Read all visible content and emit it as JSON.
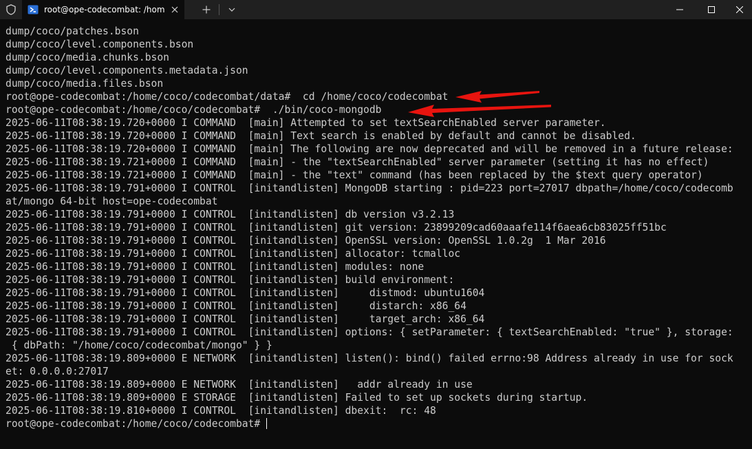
{
  "tab": {
    "title": "root@ope-codecombat: /hom",
    "icon": "powershell-icon"
  },
  "titlebar": {
    "new_tab_symbol": "+",
    "dropdown_icon": "chevron-down-icon",
    "shield_icon": "shield-icon",
    "minimize_icon": "minimize-icon",
    "maximize_icon": "maximize-icon",
    "close_icon": "close-icon"
  },
  "colors": {
    "background": "#0c0c0c",
    "titlebar": "#202020",
    "text": "#cccccc",
    "arrow": "#e8140f"
  },
  "terminal": {
    "lines": [
      "dump/coco/patches.bson",
      "dump/coco/level.components.bson",
      "dump/coco/media.chunks.bson",
      "dump/coco/level.components.metadata.json",
      "dump/coco/media.files.bson",
      "root@ope-codecombat:/home/coco/codecombat/data#  cd /home/coco/codecombat",
      "root@ope-codecombat:/home/coco/codecombat#  ./bin/coco-mongodb",
      "2025-06-11T08:38:19.720+0000 I COMMAND  [main] Attempted to set textSearchEnabled server parameter.",
      "2025-06-11T08:38:19.720+0000 I COMMAND  [main] Text search is enabled by default and cannot be disabled.",
      "2025-06-11T08:38:19.720+0000 I COMMAND  [main] The following are now deprecated and will be removed in a future release:",
      "2025-06-11T08:38:19.721+0000 I COMMAND  [main] - the \"textSearchEnabled\" server parameter (setting it has no effect)",
      "2025-06-11T08:38:19.721+0000 I COMMAND  [main] - the \"text\" command (has been replaced by the $text query operator)",
      "2025-06-11T08:38:19.791+0000 I CONTROL  [initandlisten] MongoDB starting : pid=223 port=27017 dbpath=/home/coco/codecomb",
      "at/mongo 64-bit host=ope-codecombat",
      "2025-06-11T08:38:19.791+0000 I CONTROL  [initandlisten] db version v3.2.13",
      "2025-06-11T08:38:19.791+0000 I CONTROL  [initandlisten] git version: 23899209cad60aaafe114f6aea6cb83025ff51bc",
      "2025-06-11T08:38:19.791+0000 I CONTROL  [initandlisten] OpenSSL version: OpenSSL 1.0.2g  1 Mar 2016",
      "2025-06-11T08:38:19.791+0000 I CONTROL  [initandlisten] allocator: tcmalloc",
      "2025-06-11T08:38:19.791+0000 I CONTROL  [initandlisten] modules: none",
      "2025-06-11T08:38:19.791+0000 I CONTROL  [initandlisten] build environment:",
      "2025-06-11T08:38:19.791+0000 I CONTROL  [initandlisten]     distmod: ubuntu1604",
      "2025-06-11T08:38:19.791+0000 I CONTROL  [initandlisten]     distarch: x86_64",
      "2025-06-11T08:38:19.791+0000 I CONTROL  [initandlisten]     target_arch: x86_64",
      "2025-06-11T08:38:19.791+0000 I CONTROL  [initandlisten] options: { setParameter: { textSearchEnabled: \"true\" }, storage:",
      " { dbPath: \"/home/coco/codecombat/mongo\" } }",
      "2025-06-11T08:38:19.809+0000 E NETWORK  [initandlisten] listen(): bind() failed errno:98 Address already in use for sock",
      "et: 0.0.0.0:27017",
      "2025-06-11T08:38:19.809+0000 E NETWORK  [initandlisten]   addr already in use",
      "2025-06-11T08:38:19.809+0000 E STORAGE  [initandlisten] Failed to set up sockets during startup.",
      "2025-06-11T08:38:19.810+0000 I CONTROL  [initandlisten] dbexit:  rc: 48"
    ],
    "prompt": "root@ope-codecombat:/home/coco/codecombat# "
  }
}
